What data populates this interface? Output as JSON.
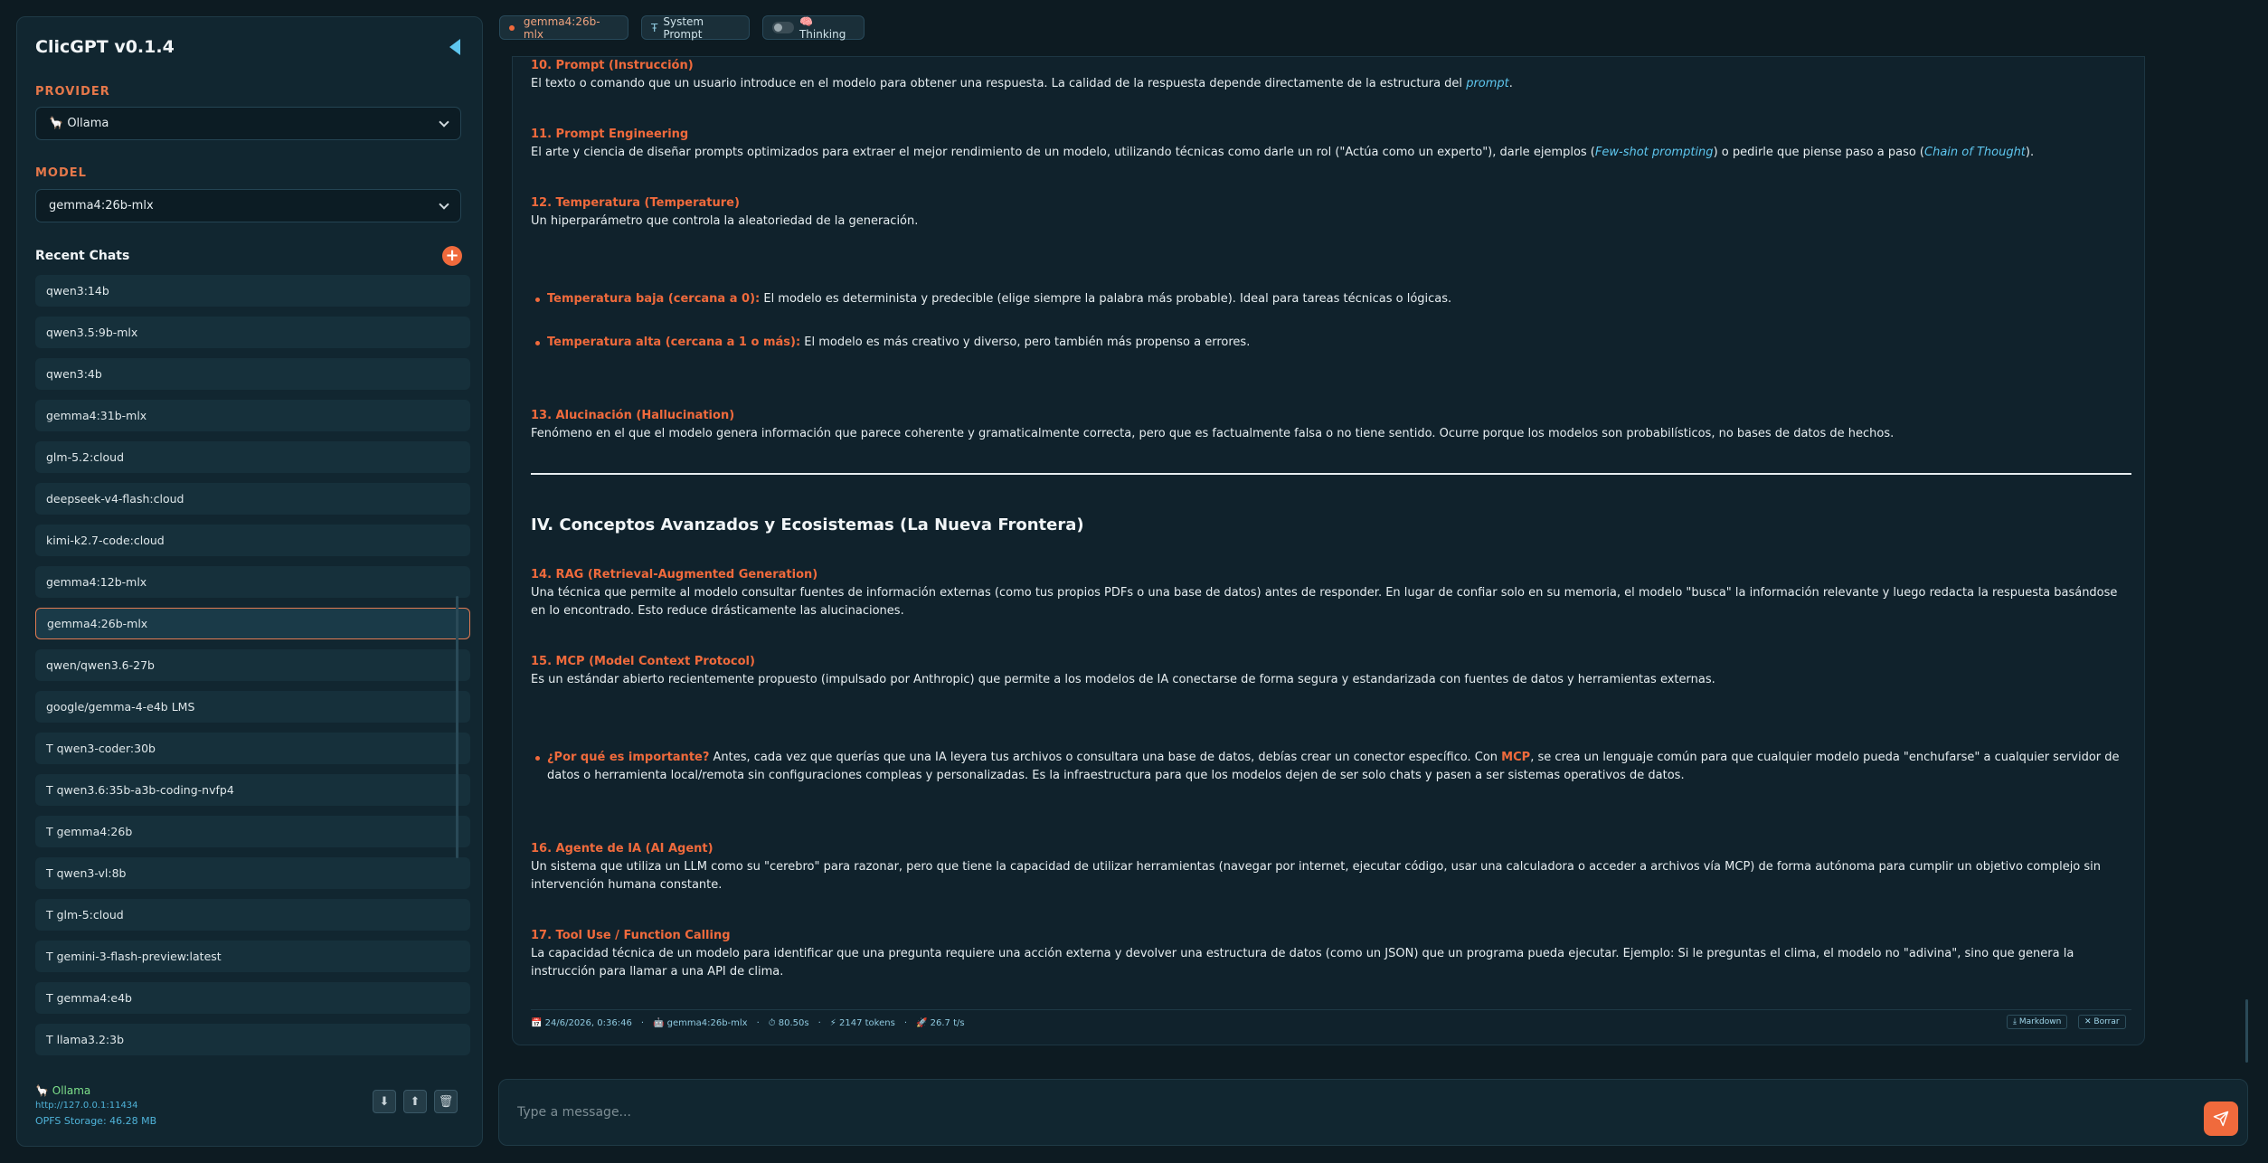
{
  "app": {
    "title": "ClicGPT v0.1.4"
  },
  "sidebar": {
    "provider_label": "PROVIDER",
    "provider_value": "🦙 Ollama",
    "model_label": "MODEL",
    "model_value": "gemma4:26b-mlx",
    "recent_label": "Recent Chats",
    "add_label": "+",
    "chats": [
      "qwen3:14b",
      "qwen3.5:9b-mlx",
      "qwen3:4b",
      "gemma4:31b-mlx",
      "glm-5.2:cloud",
      "deepseek-v4-flash:cloud",
      "kimi-k2.7-code:cloud",
      "gemma4:12b-mlx",
      "gemma4:26b-mlx",
      "qwen/qwen3.6-27b",
      "google/gemma-4-e4b LMS",
      "T qwen3-coder:30b",
      "T qwen3.6:35b-a3b-coding-nvfp4",
      "T gemma4:26b",
      "T qwen3-vl:8b",
      "T glm-5:cloud",
      "T gemini-3-flash-preview:latest",
      "T gemma4:e4b",
      "T llama3.2:3b"
    ],
    "active_index": 8,
    "footer": {
      "provider": "🦙 Ollama",
      "url": "http://127.0.0.1:11434",
      "storage": "OPFS Storage: 46.28 MB"
    }
  },
  "topbar": {
    "model_pill": "gemma4:26b-mlx",
    "system_prompt": "System Prompt",
    "thinking": "🧠Thinking"
  },
  "message": {
    "s10_h": "10. Prompt (Instrucción)",
    "s10_p1": "El texto o comando que un usuario introduce en el modelo para obtener una respuesta. La calidad de la respuesta depende directamente de la estructura del ",
    "s10_em": "prompt",
    "s10_p2": ".",
    "s11_h": "11. Prompt Engineering",
    "s11_p1": "El arte y ciencia de diseñar prompts optimizados para extraer el mejor rendimiento de un modelo, utilizando técnicas como darle un rol (\"Actúa como un experto\"), darle ejemplos (",
    "s11_em1": "Few-shot prompting",
    "s11_p2": ") o pedirle que piense paso a paso (",
    "s11_em2": "Chain of Thought",
    "s11_p3": ").",
    "s12_h": "12. Temperatura (Temperature)",
    "s12_p": "Un hiperparámetro que controla la aleatoriedad de la generación.",
    "s12_b1_h": "Temperatura baja (cercana a 0):",
    "s12_b1_p": " El modelo es determinista y predecible (elige siempre la palabra más probable). Ideal para tareas técnicas o lógicas.",
    "s12_b2_h": "Temperatura alta (cercana a 1 o más):",
    "s12_b2_p": " El modelo es más creativo y diverso, pero también más propenso a errores.",
    "s13_h": "13. Alucinación (Hallucination)",
    "s13_p": "Fenómeno en el que el modelo genera información que parece coherente y gramaticalmente correcta, pero que es factualmente falsa o no tiene sentido. Ocurre porque los modelos son probabilísticos, no bases de datos de hechos.",
    "sec4_title": "IV. Conceptos Avanzados y Ecosistemas (La Nueva Frontera)",
    "s14_h": "14. RAG (Retrieval-Augmented Generation)",
    "s14_p": "Una técnica que permite al modelo consultar fuentes de información externas (como tus propios PDFs o una base de datos) antes de responder. En lugar de confiar solo en su memoria, el modelo \"busca\" la información relevante y luego redacta la respuesta basándose en lo encontrado. Esto reduce drásticamente las alucinaciones.",
    "s15_h": "15. MCP (Model Context Protocol)",
    "s15_p": "Es un estándar abierto recientemente propuesto (impulsado por Anthropic) que permite a los modelos de IA conectarse de forma segura y estandarizada con fuentes de datos y herramientas externas.",
    "s15_b_h": "¿Por qué es importante?",
    "s15_b_p1": " Antes, cada vez que querías que una IA leyera tus archivos o consultara una base de datos, debías crear un conector específico. Con ",
    "s15_b_mcp": "MCP",
    "s15_b_p2": ", se crea un lenguaje común para que cualquier modelo pueda \"enchufarse\" a cualquier servidor de datos o herramienta local/remota sin configuraciones compleas y personalizadas. Es la infraestructura para que los modelos dejen de ser solo chats y pasen a ser sistemas operativos de datos.",
    "s16_h": "16. Agente de IA (AI Agent)",
    "s16_p": "Un sistema que utiliza un LLM como su \"cerebro\" para razonar, pero que tiene la capacidad de utilizar herramientas (navegar por internet, ejecutar código, usar una calculadora o acceder a archivos vía MCP) de forma autónoma para cumplir un objetivo complejo sin intervención humana constante.",
    "s17_h": "17. Tool Use / Function Calling",
    "s17_p": "La capacidad técnica de un modelo para identificar que una pregunta requiere una acción externa y devolver una estructura de datos (como un JSON) que un programa pueda ejecutar. Ejemplo: Si le preguntas el clima, el modelo no \"adivina\", sino que genera la instrucción para llamar a una API de clima."
  },
  "meta": {
    "date": "📅 24/6/2026, 0:36:46",
    "model": "🤖 gemma4:26b-mlx",
    "time": "⏱ 80.50s",
    "tokens": "⚡ 2147 tokens",
    "speed": "🚀 26.7 t/s",
    "markdown": "⤓ Markdown",
    "delete": "✕ Borrar",
    "sep": "·"
  },
  "composer": {
    "placeholder": "Type a message..."
  },
  "colors": {
    "accent": "#f06a3c",
    "link": "#5ec6ee",
    "bg": "#0d1b22",
    "panel": "#112630"
  }
}
